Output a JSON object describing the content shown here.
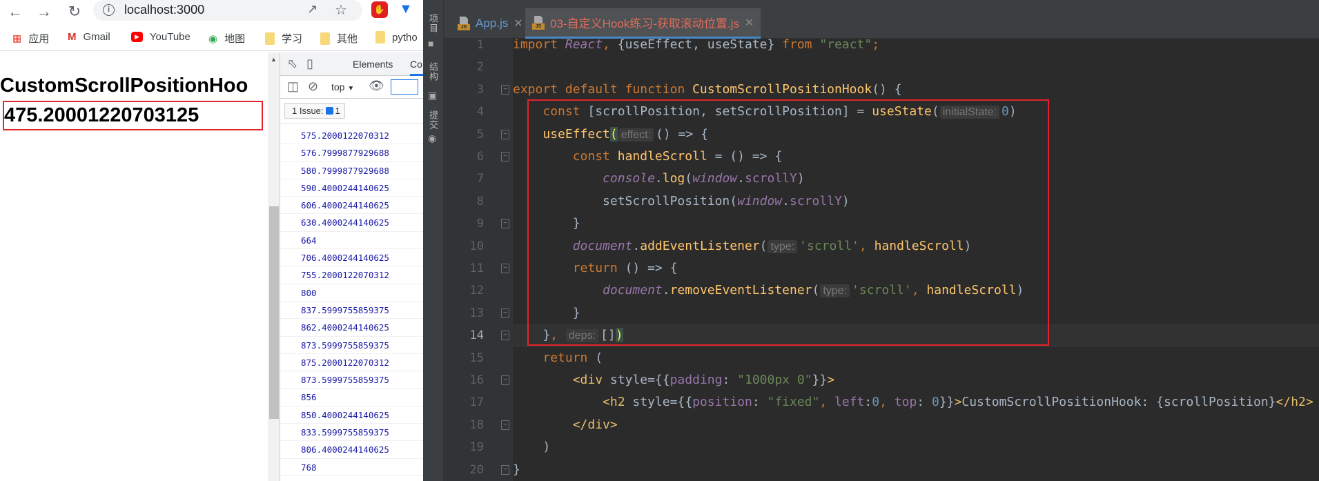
{
  "browser": {
    "nav": {
      "back_icon": "arrow-left",
      "forward_icon": "arrow-right",
      "reload_icon": "reload"
    },
    "url": "localhost:3000",
    "bookmarks": [
      {
        "label": "应用",
        "icon": "apps-grid"
      },
      {
        "label": "Gmail",
        "icon": "gmail"
      },
      {
        "label": "YouTube",
        "icon": "youtube"
      },
      {
        "label": "地图",
        "icon": "maps"
      },
      {
        "label": "学习",
        "icon": "folder"
      },
      {
        "label": "其他",
        "icon": "folder"
      },
      {
        "label": "pytho",
        "icon": "folder"
      }
    ],
    "page": {
      "heading": "CustomScrollPositionHoo",
      "scroll_value": "475.20001220703125"
    }
  },
  "devtools": {
    "tabs": [
      "Elements",
      "Co"
    ],
    "context": "top",
    "issues": {
      "label": "1 Issue:",
      "count": "1"
    },
    "console_logs": [
      "575.2000122070312",
      "576.7999877929688",
      "580.7999877929688",
      "590.4000244140625",
      "606.4000244140625",
      "630.4000244140625",
      "664",
      "706.4000244140625",
      "755.2000122070312",
      "800",
      "837.5999755859375",
      "862.4000244140625",
      "873.5999755859375",
      "875.2000122070312",
      "873.5999755859375",
      "856",
      "850.4000244140625",
      "833.5999755859375",
      "806.4000244140625",
      "768"
    ]
  },
  "ide": {
    "side_tools": [
      "项目",
      "结构",
      "提交"
    ],
    "tabs": [
      {
        "label": "App.js",
        "active": false,
        "color": "#6b9bd2"
      },
      {
        "label": "03-自定义Hook练习-获取滚动位置.js",
        "active": true,
        "color": "#e06c5a"
      }
    ],
    "current_line": 14,
    "code": [
      [
        [
          "k",
          "import "
        ],
        [
          "p",
          "React"
        ],
        [
          "k",
          ", "
        ],
        [
          "d",
          "{useEffect, useState} "
        ],
        [
          "k",
          "from "
        ],
        [
          "s",
          "\"react\""
        ],
        [
          "k",
          ";"
        ]
      ],
      [],
      [
        [
          "k",
          "export default function "
        ],
        [
          "f",
          "CustomScrollPositionHook"
        ],
        [
          "d",
          "() {"
        ]
      ],
      [
        [
          "d",
          "    "
        ],
        [
          "k",
          "const "
        ],
        [
          "d",
          "[scrollPosition, setScrollPosition] = "
        ],
        [
          "f",
          "useState"
        ],
        [
          "d",
          "("
        ],
        [
          "h",
          "initialState:"
        ],
        [
          "n",
          "0"
        ],
        [
          "d",
          ")"
        ]
      ],
      [
        [
          "d",
          "    "
        ],
        [
          "f",
          "useEffect"
        ],
        [
          "bm-hl",
          "("
        ],
        [
          "h",
          "effect:"
        ],
        [
          "d",
          "() => {"
        ]
      ],
      [
        [
          "d",
          "        "
        ],
        [
          "k",
          "const "
        ],
        [
          "f",
          "handleScroll"
        ],
        [
          "d",
          " = () => {"
        ]
      ],
      [
        [
          "d",
          "            "
        ],
        [
          "p",
          "console"
        ],
        [
          "d",
          "."
        ],
        [
          "f",
          "log"
        ],
        [
          "d",
          "("
        ],
        [
          "p",
          "window"
        ],
        [
          "d",
          "."
        ],
        [
          "pv",
          "scrollY"
        ],
        [
          "d",
          ")"
        ]
      ],
      [
        [
          "d",
          "            setScrollPosition("
        ],
        [
          "p",
          "window"
        ],
        [
          "d",
          "."
        ],
        [
          "pv",
          "scrollY"
        ],
        [
          "d",
          ")"
        ]
      ],
      [
        [
          "d",
          "        }"
        ]
      ],
      [
        [
          "d",
          "        "
        ],
        [
          "p",
          "document"
        ],
        [
          "d",
          "."
        ],
        [
          "f",
          "addEventListener"
        ],
        [
          "d",
          "("
        ],
        [
          "h",
          "type:"
        ],
        [
          "s",
          "'scroll'"
        ],
        [
          "k",
          ", "
        ],
        [
          "f",
          "handleScroll"
        ],
        [
          "d",
          ")"
        ]
      ],
      [
        [
          "d",
          "        "
        ],
        [
          "k",
          "return "
        ],
        [
          "d",
          "() => {"
        ]
      ],
      [
        [
          "d",
          "            "
        ],
        [
          "p",
          "document"
        ],
        [
          "d",
          "."
        ],
        [
          "f",
          "removeEventListener"
        ],
        [
          "d",
          "("
        ],
        [
          "h",
          "type:"
        ],
        [
          "s",
          "'scroll'"
        ],
        [
          "k",
          ", "
        ],
        [
          "f",
          "handleScroll"
        ],
        [
          "d",
          ")"
        ]
      ],
      [
        [
          "d",
          "        }"
        ]
      ],
      [
        [
          "d",
          "    }"
        ],
        [
          "k",
          ", "
        ],
        [
          "h",
          "deps:"
        ],
        [
          "d",
          "[]"
        ],
        [
          "bm-hl",
          ")"
        ]
      ],
      [
        [
          "d",
          "    "
        ],
        [
          "k",
          "return "
        ],
        [
          "d",
          "("
        ]
      ],
      [
        [
          "d",
          "        "
        ],
        [
          "t",
          "<div "
        ],
        [
          "d",
          "style"
        ],
        [
          "d",
          "={{"
        ],
        [
          "pv",
          "padding"
        ],
        [
          "d",
          ": "
        ],
        [
          "s",
          "\"1000px 0\""
        ],
        [
          "d",
          "}}"
        ],
        [
          "t",
          ">"
        ]
      ],
      [
        [
          "d",
          "            "
        ],
        [
          "t",
          "<h2 "
        ],
        [
          "d",
          "style={{"
        ],
        [
          "pv",
          "position"
        ],
        [
          "d",
          ": "
        ],
        [
          "s",
          "\"fixed\""
        ],
        [
          "k",
          ", "
        ],
        [
          "pv",
          "left"
        ],
        [
          "d",
          ":"
        ],
        [
          "n",
          "0"
        ],
        [
          "k",
          ", "
        ],
        [
          "pv",
          "top"
        ],
        [
          "d",
          ": "
        ],
        [
          "n",
          "0"
        ],
        [
          "d",
          "}}"
        ],
        [
          "t",
          ">"
        ],
        [
          "d",
          "CustomScrollPositionHook: {scrollPosition}"
        ],
        [
          "t",
          "</h2>"
        ]
      ],
      [
        [
          "d",
          "        "
        ],
        [
          "t",
          "</div>"
        ]
      ],
      [
        [
          "d",
          "    )"
        ]
      ],
      [
        [
          "d",
          "}"
        ]
      ]
    ],
    "fold_open_lines": [
      3,
      5,
      6,
      11,
      16
    ],
    "fold_close_lines": [
      9,
      13,
      14,
      18,
      20
    ],
    "annotation_color": "#e3242b"
  }
}
